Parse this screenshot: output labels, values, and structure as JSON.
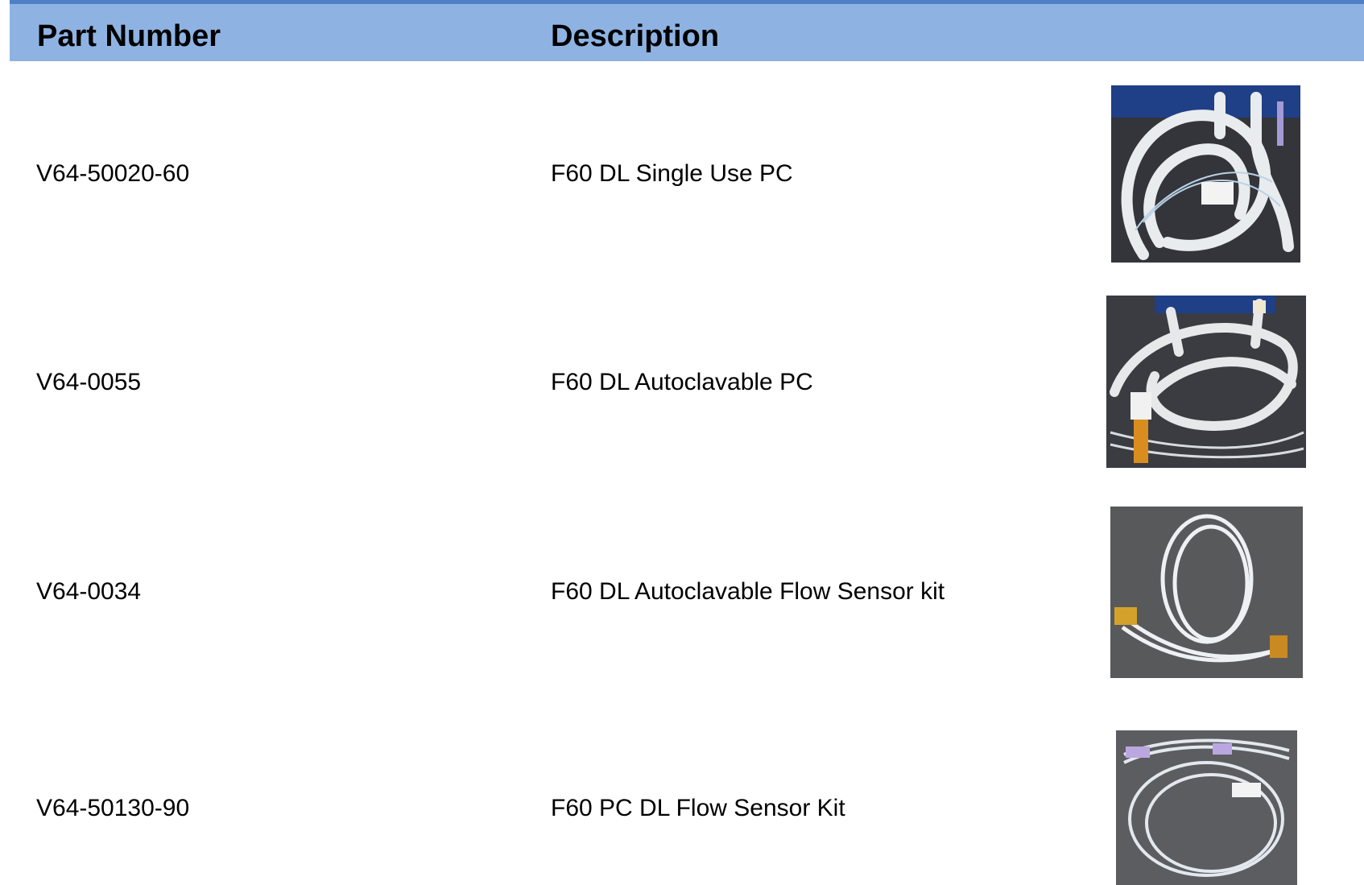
{
  "table": {
    "headers": {
      "part_number": "Part Number",
      "description": "Description"
    },
    "rows": [
      {
        "part_number": "V64-50020-60",
        "description": "F60 DL Single Use PC",
        "image": "circuit-photo-single-use"
      },
      {
        "part_number": "V64-0055",
        "description": "F60 DL Autoclavable PC",
        "image": "circuit-photo-autoclavable"
      },
      {
        "part_number": "V64-0034",
        "description": "F60 DL Autoclavable Flow Sensor kit",
        "image": "flow-sensor-kit-photo-autoclavable"
      },
      {
        "part_number": "V64-50130-90",
        "description": "F60 PC DL Flow Sensor Kit",
        "image": "flow-sensor-kit-photo"
      }
    ]
  },
  "colors": {
    "header_bg": "#8eb3e3",
    "header_rule": "#4f7fc6"
  }
}
